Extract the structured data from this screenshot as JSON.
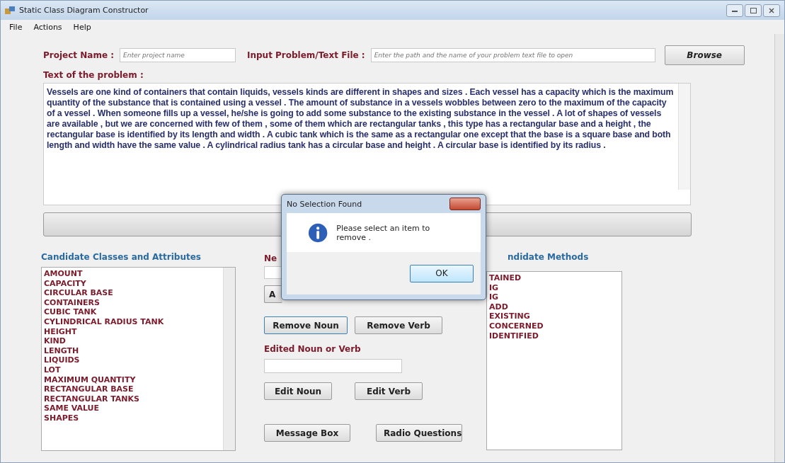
{
  "window": {
    "title": "Static Class Diagram Constructor"
  },
  "menu": [
    {
      "label": "File"
    },
    {
      "label": "Actions"
    },
    {
      "label": "Help"
    }
  ],
  "project_name": {
    "label": "Project Name :",
    "placeholder": "Enter project name"
  },
  "input_file": {
    "label": "Input Problem/Text File :",
    "placeholder": "Enter the path and the name of your problem text file to open"
  },
  "browse_button": "Browse",
  "problem": {
    "label": "Text of the problem :",
    "text": " Vessels are one kind of containers that contain liquids, vessels kinds are different in shapes and sizes . Each vessel has a capacity which is the maximum quantity of the substance that is contained using a vessel . The amount of substance in a vessels wobbles between zero to the maximum of the capacity of a vessel . When someone fills up a vessel, he/she is going to add some substance to the existing substance in the vessel . A lot of shapes of vessels are available , but we are concerned with few of them , some of them which are rectangular tanks , this type has a rectangular base and a height , the rectangular base is identified by its length and width . A cubic tank which is the same as a rectangular one except that the base is a square base and both length and width have the same value . A cylindrical radius tank has a circular base and height . A circular base is identified by its radius ."
  },
  "classes": {
    "title": "Candidate Classes and Attributes",
    "items": [
      "AMOUNT",
      "CAPACITY",
      "CIRCULAR BASE",
      "CONTAINERS",
      "CUBIC TANK",
      "CYLINDRICAL RADIUS TANK",
      "HEIGHT",
      "KIND",
      "LENGTH",
      "LIQUIDS",
      "LOT",
      "MAXIMUM QUANTITY",
      "RECTANGULAR BASE",
      "RECTANGULAR TANKS",
      "SAME VALUE",
      "SHAPES"
    ]
  },
  "new_label": "Ne",
  "add_button": "A",
  "remove_buttons": [
    "Remove Noun",
    "Remove Verb"
  ],
  "edited": {
    "label": "Edited Noun or Verb"
  },
  "edit_buttons": [
    "Edit Noun",
    "Edit Verb"
  ],
  "bottom_buttons": [
    "Message Box",
    "Radio Questions"
  ],
  "methods": {
    "title": "ndidate Methods",
    "items": [
      "TAINED",
      "IG",
      "IG",
      "ADD",
      "EXISTING",
      "CONCERNED",
      "IDENTIFIED"
    ]
  },
  "dialog": {
    "title": "No Selection Found",
    "message": "Please select an item to remove .",
    "ok": "OK"
  }
}
